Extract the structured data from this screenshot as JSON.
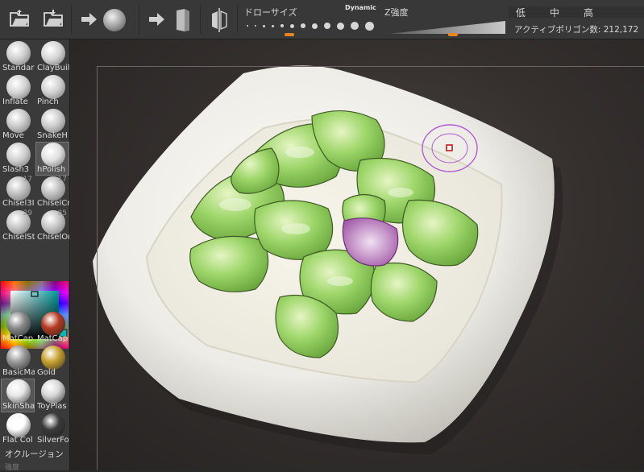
{
  "toolbar": {
    "icons": [
      "open-folder-icon",
      "save-folder-icon",
      "arrow-right-icon",
      "sphere-icon",
      "arrow-right-icon",
      "cube-icon",
      "symmetry-icon"
    ],
    "draw_size": {
      "label": "ドローサイズ",
      "dynamic_label": "Dynamic",
      "value_fraction": 0.35,
      "accent": "#e8871e"
    },
    "z_intensity": {
      "label": "Z強度",
      "value_fraction": 0.55,
      "accent": "#e8871e"
    },
    "resolution": [
      "低",
      "中",
      "高"
    ],
    "active_polygons": {
      "label": "アクティブポリゴン数:",
      "value": "212,172"
    }
  },
  "brushes": [
    {
      "label": "Standar",
      "count": ""
    },
    {
      "label": "ClayBuil",
      "count": ""
    },
    {
      "label": "Inflate",
      "count": ""
    },
    {
      "label": "Pinch",
      "count": ""
    },
    {
      "label": "Move",
      "count": ""
    },
    {
      "label": "SnakeH",
      "count": ""
    },
    {
      "label": "Slash3",
      "count": ""
    },
    {
      "label": "hPolish",
      "count": "",
      "selected": true
    },
    {
      "label": "Chisel3I",
      "count": "17"
    },
    {
      "label": "ChiselCr",
      "count": "17"
    },
    {
      "label": "ChiselSt",
      "count": "29"
    },
    {
      "label": "ChiselOr",
      "count": "85"
    }
  ],
  "materials": [
    {
      "label": "MatCap",
      "color": "#8a8a8a"
    },
    {
      "label": "MatCap",
      "color": "#b33a22"
    },
    {
      "label": "BasicMa",
      "color": "#9a9a9a"
    },
    {
      "label": "Gold",
      "color": "#c8a22e"
    },
    {
      "label": "SkinSha",
      "color": "#e8e8e8",
      "selected": true
    },
    {
      "label": "ToyPlas",
      "color": "#d8d8d8"
    },
    {
      "label": "Flat Col",
      "color": "#ffffff"
    },
    {
      "label": "SilverFo",
      "color": "#3a3a3a"
    }
  ],
  "color_picker": {
    "hue": "#009a9a",
    "secondary": "#00b8b8"
  },
  "occlusion_label": "オクルージョン",
  "intensity_label": "強度"
}
